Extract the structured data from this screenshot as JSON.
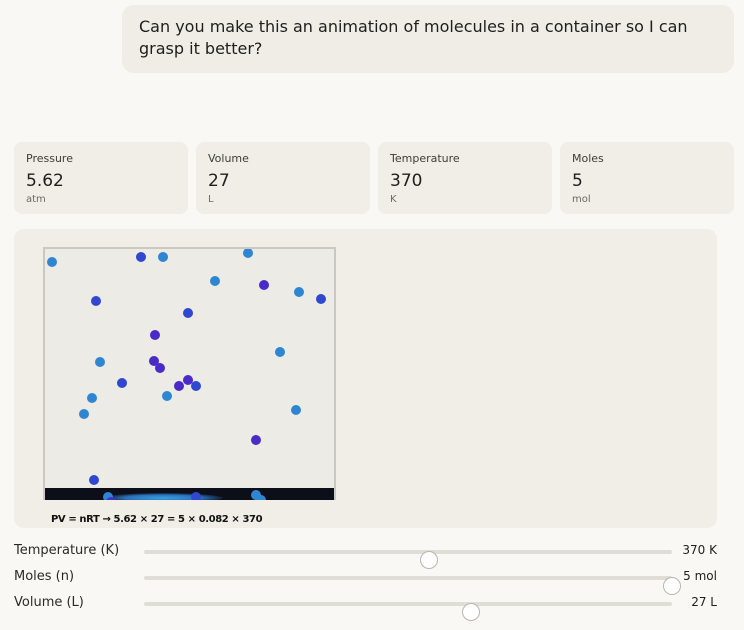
{
  "message": {
    "text": "Can you make this an animation of molecules in a container so  I can grasp it better?"
  },
  "stats": [
    {
      "label": "Pressure",
      "value": "5.62",
      "unit": "atm"
    },
    {
      "label": "Volume",
      "value": "27",
      "unit": "L"
    },
    {
      "label": "Temperature",
      "value": "370",
      "unit": "K"
    },
    {
      "label": "Moles",
      "value": "5",
      "unit": "mol"
    }
  ],
  "simulation": {
    "equation": "PV = nRT  →  5.62 × 27 = 5 × 0.082 × 370",
    "colors": {
      "light": "#2e86d2",
      "mid": "#2f48cf",
      "dark": "#4a2bc8"
    }
  },
  "sliders": [
    {
      "label": "Temperature (K)",
      "value_label": "370 K",
      "fraction": 0.54
    },
    {
      "label": "Moles (n)",
      "value_label": "5 mol",
      "fraction": 1.0
    },
    {
      "label": "Volume (L)",
      "value_label": "27 L",
      "fraction": 0.62
    }
  ]
}
